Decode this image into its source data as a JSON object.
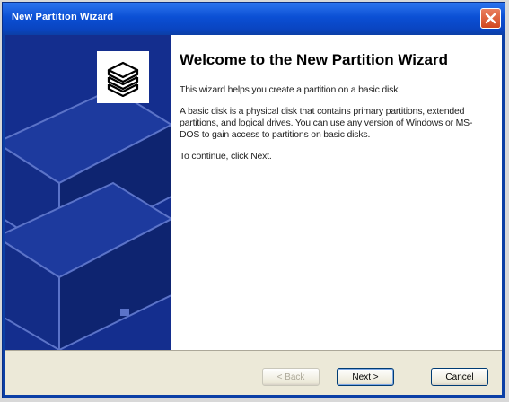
{
  "window": {
    "title": "New Partition Wizard"
  },
  "titlebar": {
    "close_icon": "close-icon"
  },
  "side_panel": {
    "icon": "disk-stack-icon",
    "art": "disk-drives-illustration"
  },
  "content": {
    "heading": "Welcome to the New Partition Wizard",
    "intro": "This wizard helps you create a partition on a basic disk.",
    "description": "A basic disk is a physical disk that contains primary partitions, extended partitions, and logical drives. You can use any version of Windows or MS-DOS to gain access to partitions on basic disks.",
    "continue": "To continue, click Next."
  },
  "footer": {
    "back_label": "< Back",
    "next_label": "Next >",
    "cancel_label": "Cancel"
  },
  "colors": {
    "titlebar": "#0b4fd4",
    "side_panel": "#142e8e",
    "footer": "#ece9d8",
    "close_button": "#d2461e"
  }
}
